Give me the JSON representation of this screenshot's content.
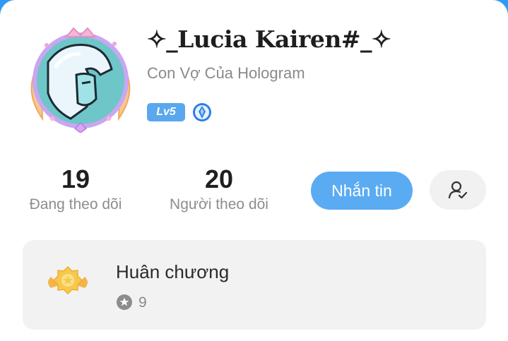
{
  "profile": {
    "display_name": "✧_Lucia Kairen#_✧",
    "tagline": "Con Vợ Của Hologram",
    "level": "Lv5"
  },
  "stats": {
    "following_count": "19",
    "following_label": "Đang theo dõi",
    "followers_count": "20",
    "followers_label": "Người theo dõi"
  },
  "actions": {
    "message_label": "Nhắn tin"
  },
  "medals": {
    "title": "Huân chương",
    "count": "9"
  },
  "icons": {
    "avatar": "avatar-with-winged-frame",
    "verify": "verified-crystal-icon",
    "followed": "user-check-icon",
    "medal": "winged-medal-icon",
    "count": "star-circle-icon"
  },
  "colors": {
    "accent": "#5aabf2",
    "header_blue": "#2f9af3",
    "level_badge": "#5aa7ee",
    "panel": "#f2f2f2"
  }
}
